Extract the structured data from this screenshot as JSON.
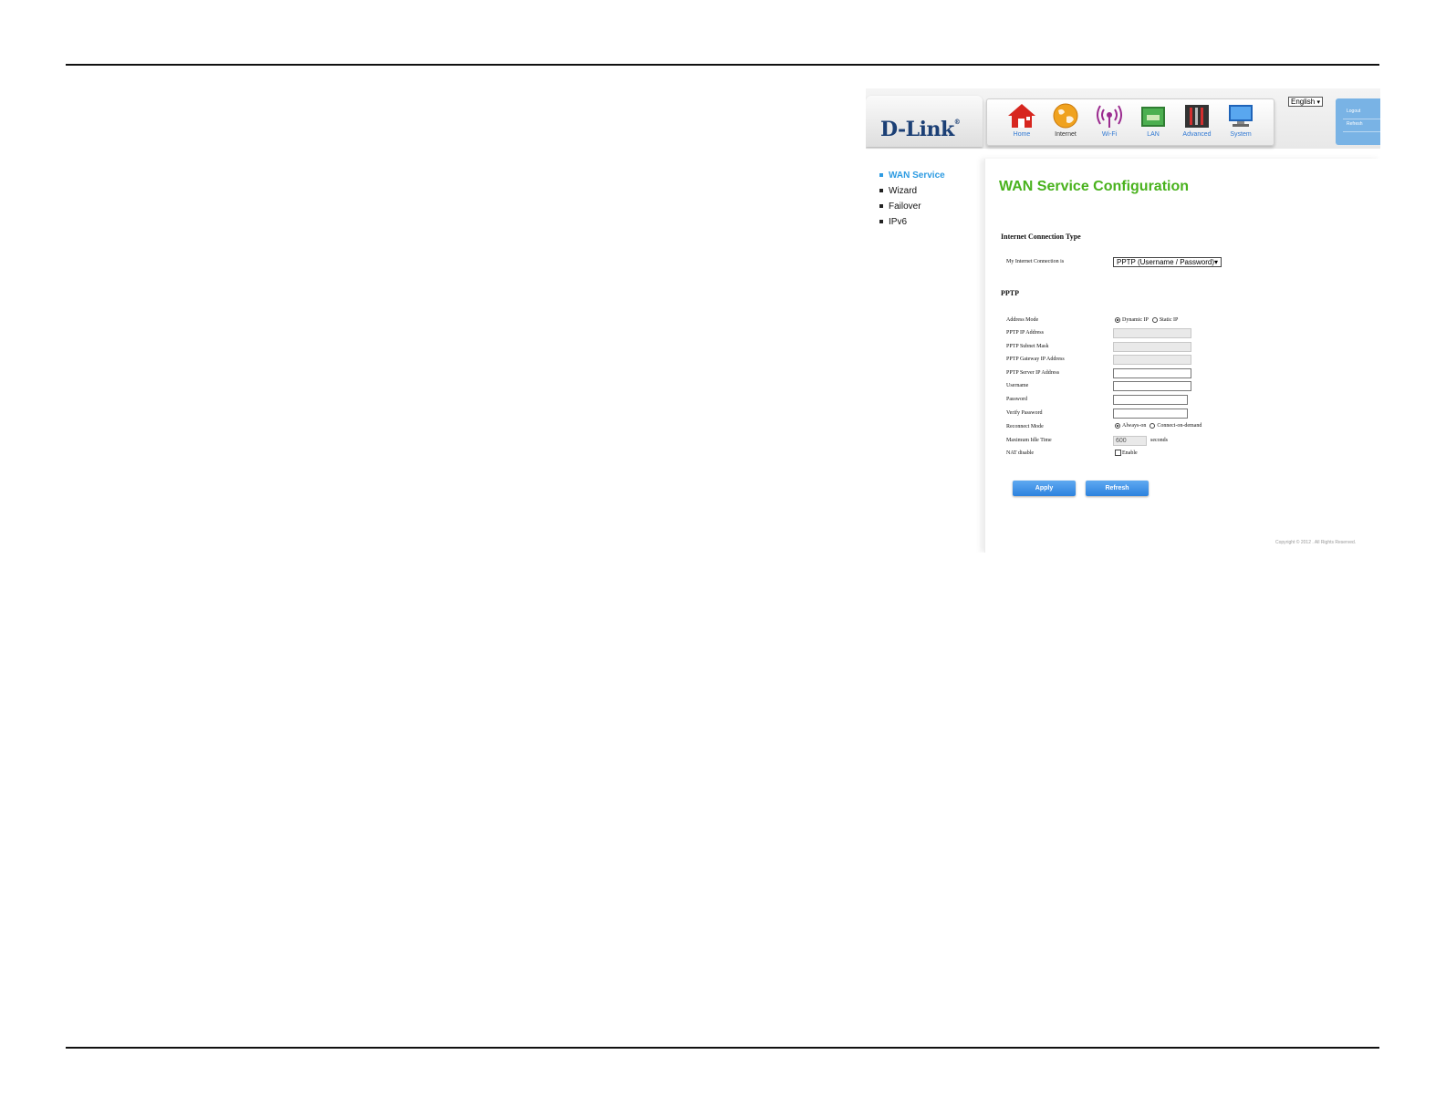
{
  "nav": {
    "brand": "D-Link",
    "items": [
      {
        "label": "Home",
        "icon": "home-icon"
      },
      {
        "label": "Internet",
        "icon": "globe-icon"
      },
      {
        "label": "Wi-Fi",
        "icon": "wifi-icon"
      },
      {
        "label": "LAN",
        "icon": "lan-icon"
      },
      {
        "label": "Advanced",
        "icon": "tools-icon"
      },
      {
        "label": "System",
        "icon": "monitor-icon"
      }
    ],
    "active": "Internet",
    "language": "English",
    "logout": "Logout",
    "refresh": "Refresh"
  },
  "sidebar": {
    "items": [
      {
        "label": "WAN Service",
        "active": true
      },
      {
        "label": "Wizard",
        "active": false
      },
      {
        "label": "Failover",
        "active": false
      },
      {
        "label": "IPv6",
        "active": false
      }
    ]
  },
  "main": {
    "title": "WAN Service Configuration",
    "section_connection": "Internet Connection Type",
    "connection_label": "My Internet Connection is",
    "connection_value": "PPTP (Username / Password)",
    "section_pptp": "PPTP",
    "fields": {
      "address_mode": "Address Mode",
      "address_mode_opt1": "Dynamic IP",
      "address_mode_opt2": "Static IP",
      "ip_address": "PPTP IP Address",
      "subnet_mask": "PPTP Subnet Mask",
      "gateway_ip": "PPTP Gateway IP Address",
      "server_ip": "PPTP Server IP Address",
      "username": "Username",
      "password": "Password",
      "verify_password": "Verify Password",
      "reconnect_mode": "Reconnect Mode",
      "reconnect_opt1": "Always-on",
      "reconnect_opt2": "Connect-on-demand",
      "max_idle": "Maximum Idle Time",
      "max_idle_value": "600",
      "max_idle_unit": "seconds",
      "nat_disable": "NAT disable",
      "nat_enable": "Enable"
    },
    "apply": "Apply",
    "refresh": "Refresh",
    "copyright": "Copyright © 2012 . All Rights Reserved."
  },
  "colors": {
    "title_green": "#49b21d",
    "active_blue": "#2d9be2",
    "button_blue": "#2c82de",
    "user_box_blue": "#79b3e5"
  }
}
